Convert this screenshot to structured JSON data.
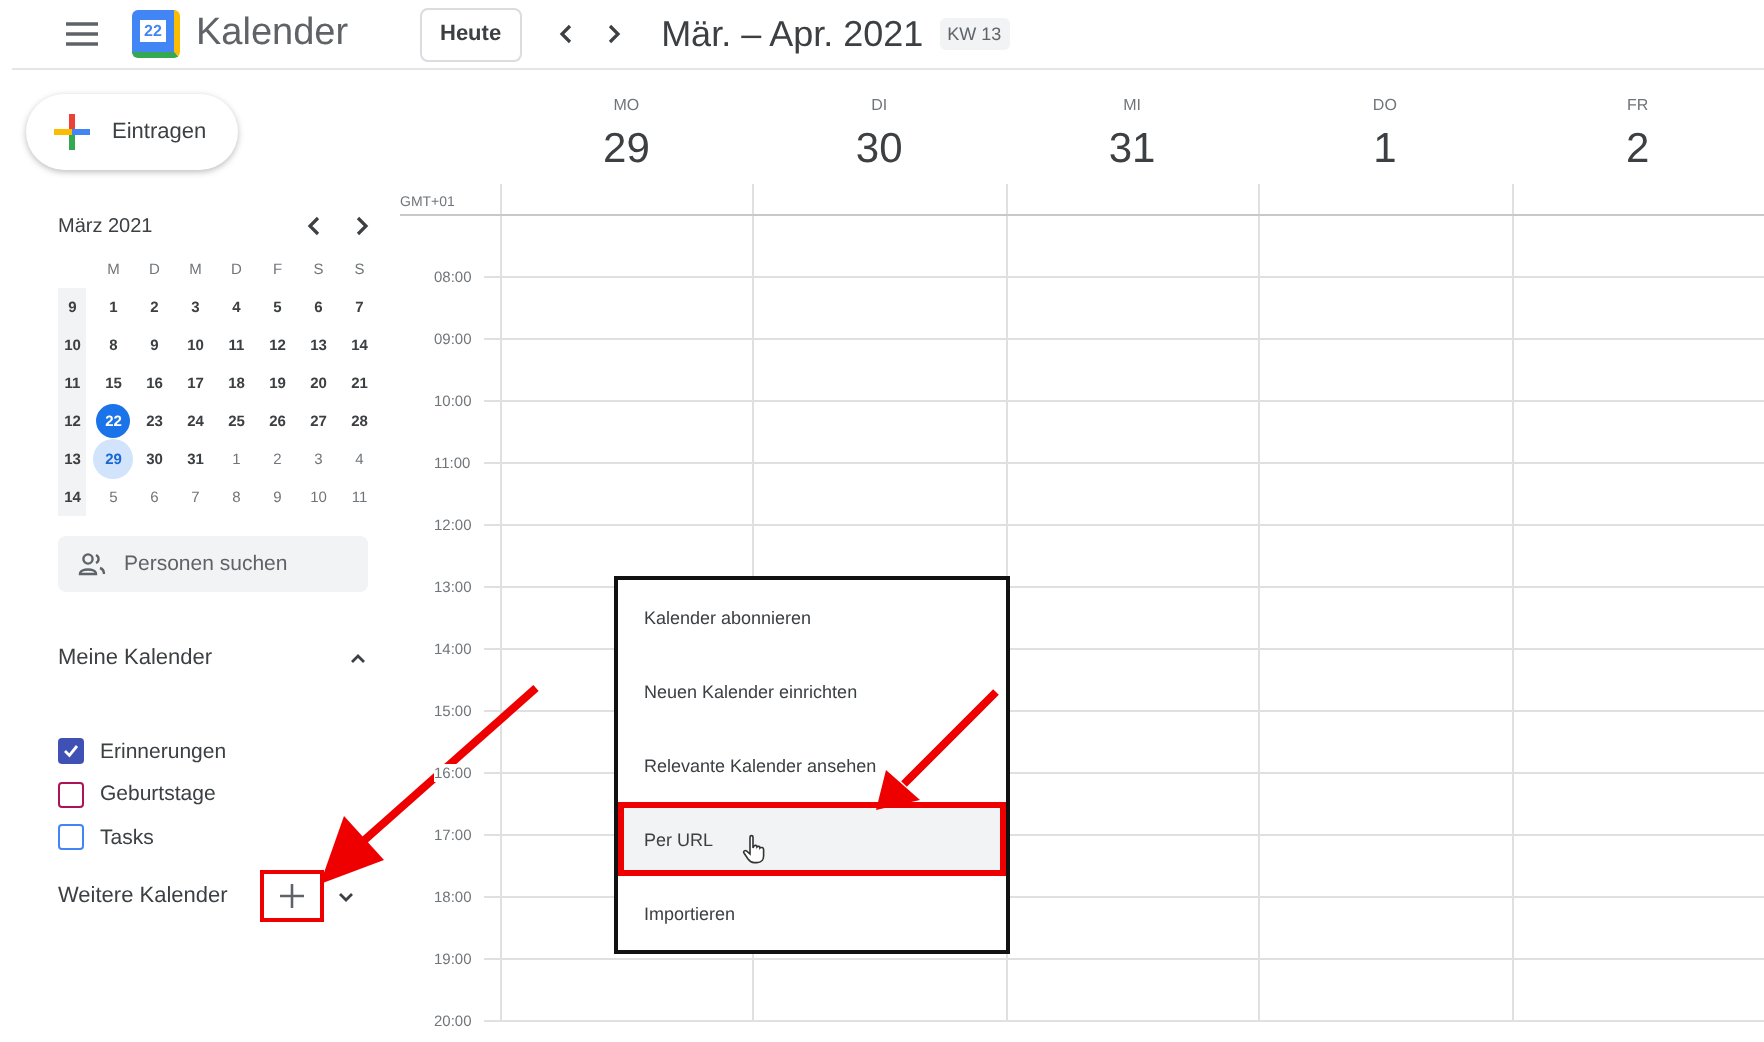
{
  "header": {
    "app_name": "Kalender",
    "logo_day": "22",
    "today_button": "Heute",
    "range_title": "Mär. – Apr. 2021",
    "week_badge": "KW 13"
  },
  "create_button": "Eintragen",
  "mini_calendar": {
    "title": "März 2021",
    "weekdays": [
      "M",
      "D",
      "M",
      "D",
      "F",
      "S",
      "S"
    ],
    "weeks": [
      {
        "number": "9",
        "days": [
          {
            "label": "1",
            "in_month": true,
            "today": false,
            "selected": false
          },
          {
            "label": "2",
            "in_month": true,
            "today": false,
            "selected": false
          },
          {
            "label": "3",
            "in_month": true,
            "today": false,
            "selected": false
          },
          {
            "label": "4",
            "in_month": true,
            "today": false,
            "selected": false
          },
          {
            "label": "5",
            "in_month": true,
            "today": false,
            "selected": false
          },
          {
            "label": "6",
            "in_month": true,
            "today": false,
            "selected": false
          },
          {
            "label": "7",
            "in_month": true,
            "today": false,
            "selected": false
          }
        ]
      },
      {
        "number": "10",
        "days": [
          {
            "label": "8",
            "in_month": true,
            "today": false,
            "selected": false
          },
          {
            "label": "9",
            "in_month": true,
            "today": false,
            "selected": false
          },
          {
            "label": "10",
            "in_month": true,
            "today": false,
            "selected": false
          },
          {
            "label": "11",
            "in_month": true,
            "today": false,
            "selected": false
          },
          {
            "label": "12",
            "in_month": true,
            "today": false,
            "selected": false
          },
          {
            "label": "13",
            "in_month": true,
            "today": false,
            "selected": false
          },
          {
            "label": "14",
            "in_month": true,
            "today": false,
            "selected": false
          }
        ]
      },
      {
        "number": "11",
        "days": [
          {
            "label": "15",
            "in_month": true,
            "today": false,
            "selected": false
          },
          {
            "label": "16",
            "in_month": true,
            "today": false,
            "selected": false
          },
          {
            "label": "17",
            "in_month": true,
            "today": false,
            "selected": false
          },
          {
            "label": "18",
            "in_month": true,
            "today": false,
            "selected": false
          },
          {
            "label": "19",
            "in_month": true,
            "today": false,
            "selected": false
          },
          {
            "label": "20",
            "in_month": true,
            "today": false,
            "selected": false
          },
          {
            "label": "21",
            "in_month": true,
            "today": false,
            "selected": false
          }
        ]
      },
      {
        "number": "12",
        "days": [
          {
            "label": "22",
            "in_month": true,
            "today": true,
            "selected": false
          },
          {
            "label": "23",
            "in_month": true,
            "today": false,
            "selected": false
          },
          {
            "label": "24",
            "in_month": true,
            "today": false,
            "selected": false
          },
          {
            "label": "25",
            "in_month": true,
            "today": false,
            "selected": false
          },
          {
            "label": "26",
            "in_month": true,
            "today": false,
            "selected": false
          },
          {
            "label": "27",
            "in_month": true,
            "today": false,
            "selected": false
          },
          {
            "label": "28",
            "in_month": true,
            "today": false,
            "selected": false
          }
        ]
      },
      {
        "number": "13",
        "days": [
          {
            "label": "29",
            "in_month": true,
            "today": false,
            "selected": true
          },
          {
            "label": "30",
            "in_month": true,
            "today": false,
            "selected": false
          },
          {
            "label": "31",
            "in_month": true,
            "today": false,
            "selected": false
          },
          {
            "label": "1",
            "in_month": false,
            "today": false,
            "selected": false
          },
          {
            "label": "2",
            "in_month": false,
            "today": false,
            "selected": false
          },
          {
            "label": "3",
            "in_month": false,
            "today": false,
            "selected": false
          },
          {
            "label": "4",
            "in_month": false,
            "today": false,
            "selected": false
          }
        ]
      },
      {
        "number": "14",
        "days": [
          {
            "label": "5",
            "in_month": false,
            "today": false,
            "selected": false
          },
          {
            "label": "6",
            "in_month": false,
            "today": false,
            "selected": false
          },
          {
            "label": "7",
            "in_month": false,
            "today": false,
            "selected": false
          },
          {
            "label": "8",
            "in_month": false,
            "today": false,
            "selected": false
          },
          {
            "label": "9",
            "in_month": false,
            "today": false,
            "selected": false
          },
          {
            "label": "10",
            "in_month": false,
            "today": false,
            "selected": false
          },
          {
            "label": "11",
            "in_month": false,
            "today": false,
            "selected": false
          }
        ]
      }
    ]
  },
  "people_search": {
    "placeholder": "Personen suchen"
  },
  "my_calendars": {
    "title": "Meine Kalender",
    "expanded": true,
    "items": [
      {
        "label": "Erinnerungen",
        "checked": true,
        "color": "#3f51b5"
      },
      {
        "label": "Geburtstage",
        "checked": false,
        "color": "#ad1457"
      },
      {
        "label": "Tasks",
        "checked": false,
        "color": "#4285f4"
      }
    ]
  },
  "other_calendars": {
    "title": "Weitere Kalender",
    "expanded": false
  },
  "week": {
    "timezone": "GMT+01",
    "days": [
      {
        "weekday": "MO",
        "date": "29"
      },
      {
        "weekday": "DI",
        "date": "30"
      },
      {
        "weekday": "MI",
        "date": "31"
      },
      {
        "weekday": "DO",
        "date": "1"
      },
      {
        "weekday": "FR",
        "date": "2"
      }
    ],
    "hours": [
      "08:00",
      "09:00",
      "10:00",
      "11:00",
      "12:00",
      "13:00",
      "14:00",
      "15:00",
      "16:00",
      "17:00",
      "18:00",
      "19:00",
      "20:00"
    ]
  },
  "menu": {
    "items": [
      {
        "label": "Kalender abonnieren",
        "selected": false
      },
      {
        "label": "Neuen Kalender einrichten",
        "selected": false
      },
      {
        "label": "Relevante Kalender ansehen",
        "selected": false
      },
      {
        "label": "Per URL",
        "selected": true
      },
      {
        "label": "Importieren",
        "selected": false
      }
    ]
  }
}
